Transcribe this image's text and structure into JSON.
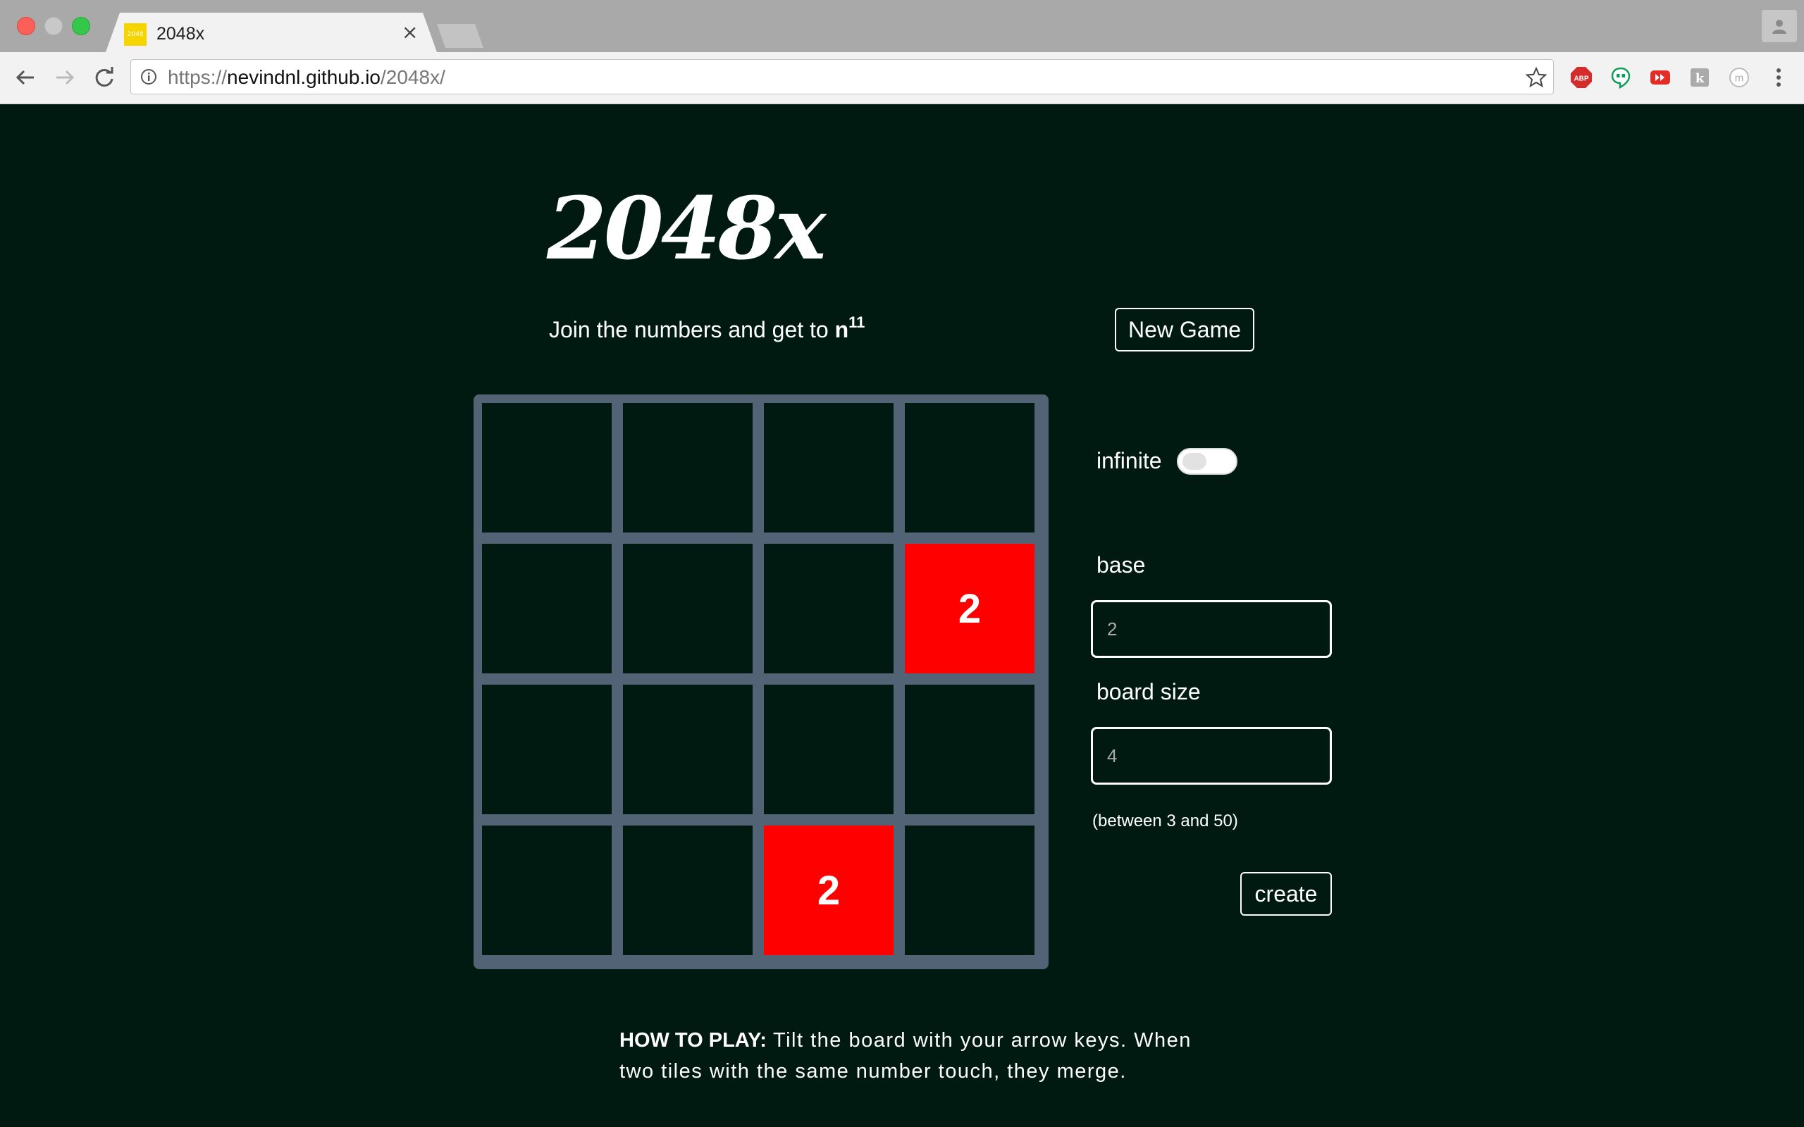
{
  "browser": {
    "tab_title": "2048x",
    "favicon_text": "2048",
    "tab_close_glyph": "×",
    "url_scheme": "https://",
    "url_host": "nevindnl.github.io",
    "url_path": "/2048x/",
    "icons": [
      "back-arrow-icon",
      "forward-arrow-icon",
      "reload-icon",
      "info-icon",
      "star-icon",
      "adblock-plus-icon",
      "hangouts-icon",
      "youtube-ext-icon",
      "extension-icon",
      "m-extension-icon",
      "menu-icon",
      "profile-icon"
    ],
    "ext_labels": {
      "adblock": "ABP",
      "m_ext": "m",
      "k_ext": "k"
    }
  },
  "game": {
    "title": "2048x",
    "subtitle_prefix": "Join the numbers and get to ",
    "subtitle_base": "n",
    "subtitle_exponent": "11",
    "new_game_label": "New Game",
    "board": {
      "size": 4,
      "cells": [
        [
          "",
          "",
          "",
          ""
        ],
        [
          "",
          "",
          "",
          "2"
        ],
        [
          "",
          "",
          "",
          ""
        ],
        [
          "",
          "",
          "2",
          ""
        ]
      ],
      "tile_color": "#ff0000",
      "background_color": "#011a11",
      "grid_color": "#536376"
    },
    "settings": {
      "infinite_label": "infinite",
      "infinite_on": false,
      "base_label": "base",
      "base_placeholder": "2",
      "board_size_label": "board size",
      "board_size_placeholder": "4",
      "board_size_hint": "(between 3 and 50)",
      "create_label": "create"
    },
    "how_to_play_label": "HOW TO PLAY:",
    "how_to_play_text": " Tilt the board with your arrow keys. When two tiles with the same number touch, they merge."
  }
}
